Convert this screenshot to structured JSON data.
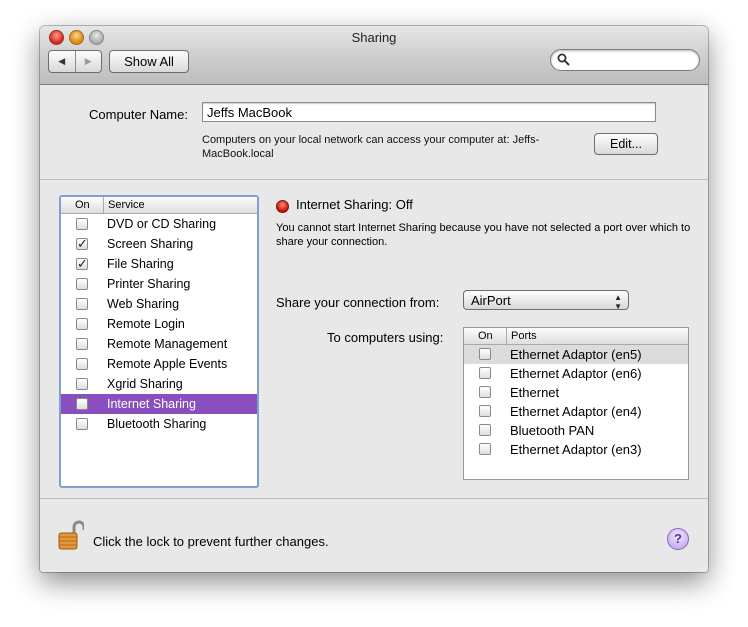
{
  "window": {
    "title": "Sharing"
  },
  "toolbar": {
    "back_glyph": "◀",
    "forward_glyph": "▶",
    "show_all_label": "Show All",
    "search_value": "",
    "search_icon": "magnifier-icon"
  },
  "computer_name": {
    "label": "Computer Name:",
    "value": "Jeffs MacBook",
    "description": "Computers on your local network can access your computer at: Jeffs-MacBook.local",
    "edit_label": "Edit..."
  },
  "services": {
    "header_on": "On",
    "header_service": "Service",
    "items": [
      {
        "label": "DVD or CD Sharing",
        "checked": false,
        "selected": false
      },
      {
        "label": "Screen Sharing",
        "checked": true,
        "selected": false
      },
      {
        "label": "File Sharing",
        "checked": true,
        "selected": false
      },
      {
        "label": "Printer Sharing",
        "checked": false,
        "selected": false
      },
      {
        "label": "Web Sharing",
        "checked": false,
        "selected": false
      },
      {
        "label": "Remote Login",
        "checked": false,
        "selected": false
      },
      {
        "label": "Remote Management",
        "checked": false,
        "selected": false
      },
      {
        "label": "Remote Apple Events",
        "checked": false,
        "selected": false
      },
      {
        "label": "Xgrid Sharing",
        "checked": false,
        "selected": false
      },
      {
        "label": "Internet Sharing",
        "checked": false,
        "selected": true
      },
      {
        "label": "Bluetooth Sharing",
        "checked": false,
        "selected": false
      }
    ]
  },
  "detail": {
    "status_text": "Internet Sharing: Off",
    "status_color": "#d01a10",
    "warning": "You cannot start Internet Sharing because you have not selected a port over which to share your connection.",
    "share_from_label": "Share your connection from:",
    "share_from_value": "AirPort",
    "to_computers_label": "To computers using:",
    "ports_header_on": "On",
    "ports_header_ports": "Ports",
    "ports": [
      {
        "label": "Ethernet Adaptor (en5)",
        "checked": false,
        "highlight": true
      },
      {
        "label": "Ethernet Adaptor (en6)",
        "checked": false,
        "highlight": false
      },
      {
        "label": "Ethernet",
        "checked": false,
        "highlight": false
      },
      {
        "label": "Ethernet Adaptor (en4)",
        "checked": false,
        "highlight": false
      },
      {
        "label": "Bluetooth PAN",
        "checked": false,
        "highlight": false
      },
      {
        "label": "Ethernet Adaptor (en3)",
        "checked": false,
        "highlight": false
      }
    ]
  },
  "footer": {
    "lock_text": "Click the lock to prevent further changes.",
    "lock_icon": "open-lock-icon",
    "help_label": "?"
  },
  "colors": {
    "selection": "#8a4fbf",
    "focus_ring": "#7da2d1"
  }
}
